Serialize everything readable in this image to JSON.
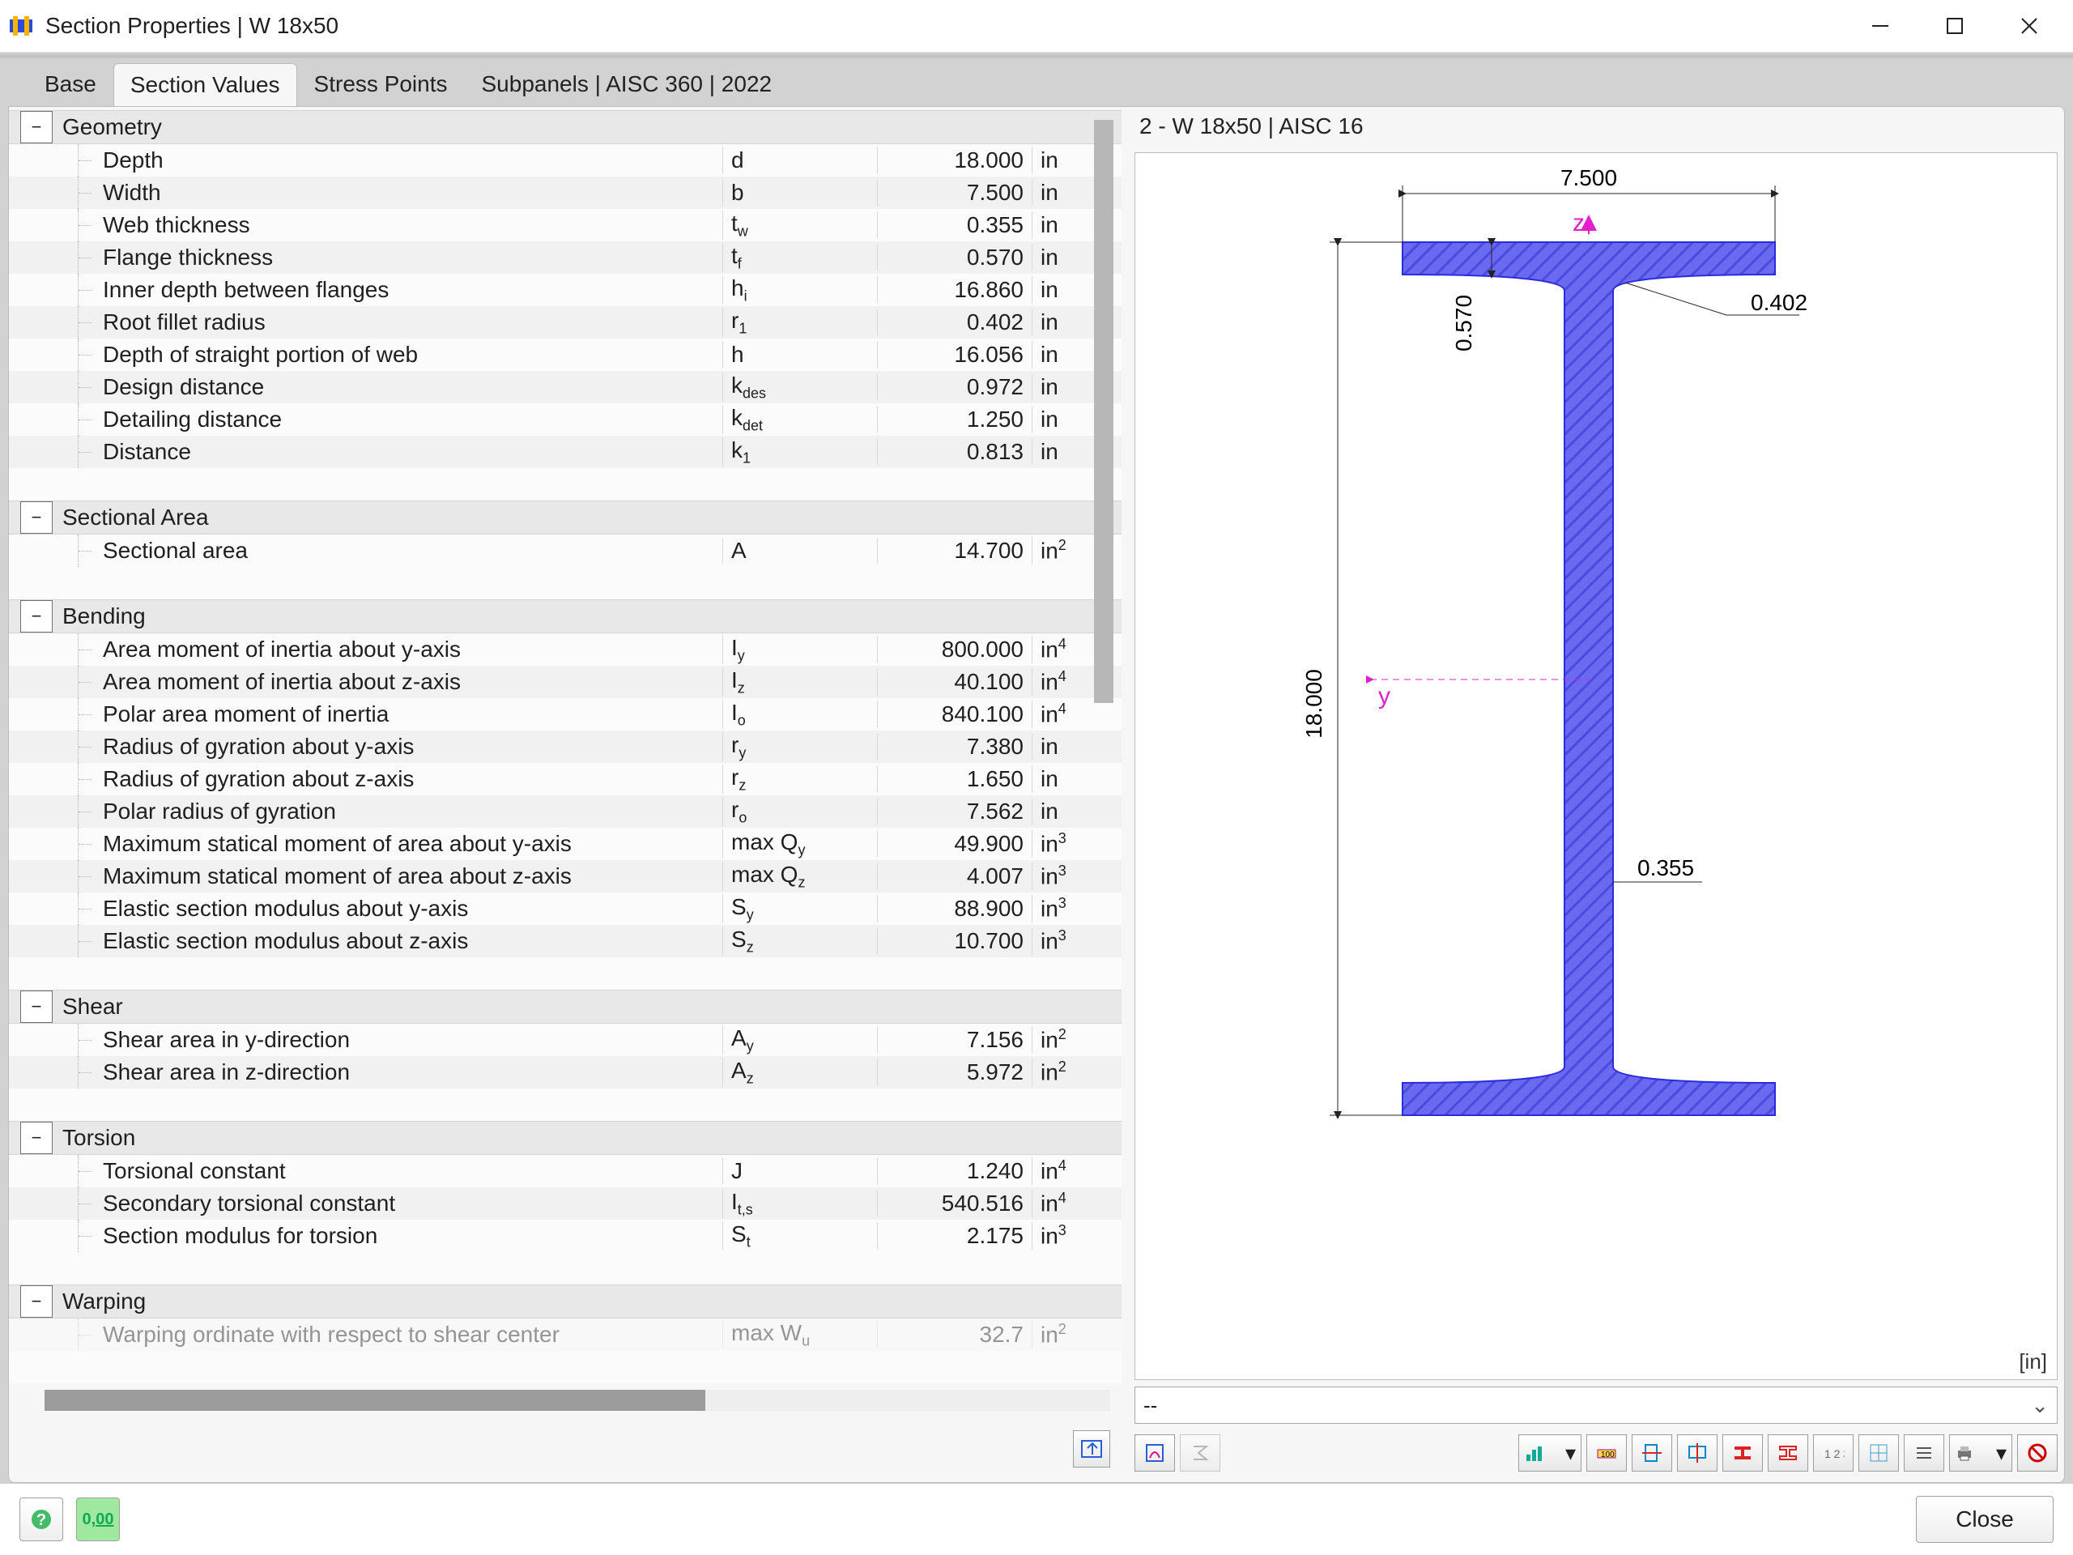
{
  "window": {
    "title": "Section Properties | W 18x50"
  },
  "tabs": [
    "Base",
    "Section Values",
    "Stress Points",
    "Subpanels | AISC 360 | 2022"
  ],
  "active_tab": 1,
  "preview_header": "2 - W 18x50 | AISC 16",
  "unit_hint": "[in]",
  "combo_value": "--",
  "footer_close": "Close",
  "diagram": {
    "depth": "18.000",
    "width": "7.500",
    "flange_t": "0.570",
    "web_t": "0.355",
    "fillet_r": "0.402",
    "axis_y": "y",
    "axis_z": "z"
  },
  "sections": [
    {
      "name": "Geometry",
      "rows": [
        {
          "label": "Depth",
          "sym": "d",
          "val": "18.000",
          "unit": "in"
        },
        {
          "label": "Width",
          "sym": "b",
          "val": "7.500",
          "unit": "in"
        },
        {
          "label": "Web thickness",
          "sym": "t<sub>w</sub>",
          "val": "0.355",
          "unit": "in"
        },
        {
          "label": "Flange thickness",
          "sym": "t<sub>f</sub>",
          "val": "0.570",
          "unit": "in"
        },
        {
          "label": "Inner depth between flanges",
          "sym": "h<sub>i</sub>",
          "val": "16.860",
          "unit": "in"
        },
        {
          "label": "Root fillet radius",
          "sym": "r<sub>1</sub>",
          "val": "0.402",
          "unit": "in"
        },
        {
          "label": "Depth of straight portion of web",
          "sym": "h",
          "val": "16.056",
          "unit": "in"
        },
        {
          "label": "Design distance",
          "sym": "k<sub>des</sub>",
          "val": "0.972",
          "unit": "in"
        },
        {
          "label": "Detailing distance",
          "sym": "k<sub>det</sub>",
          "val": "1.250",
          "unit": "in"
        },
        {
          "label": "Distance",
          "sym": "k<sub>1</sub>",
          "val": "0.813",
          "unit": "in"
        }
      ]
    },
    {
      "name": "Sectional Area",
      "rows": [
        {
          "label": "Sectional area",
          "sym": "A",
          "val": "14.700",
          "unit": "in<sup>2</sup>"
        }
      ]
    },
    {
      "name": "Bending",
      "rows": [
        {
          "label": "Area moment of inertia about y-axis",
          "sym": "I<sub>y</sub>",
          "val": "800.000",
          "unit": "in<sup>4</sup>"
        },
        {
          "label": "Area moment of inertia about z-axis",
          "sym": "I<sub>z</sub>",
          "val": "40.100",
          "unit": "in<sup>4</sup>"
        },
        {
          "label": "Polar area moment of inertia",
          "sym": "I<sub>o</sub>",
          "val": "840.100",
          "unit": "in<sup>4</sup>"
        },
        {
          "label": "Radius of gyration about y-axis",
          "sym": "r<sub>y</sub>",
          "val": "7.380",
          "unit": "in"
        },
        {
          "label": "Radius of gyration about z-axis",
          "sym": "r<sub>z</sub>",
          "val": "1.650",
          "unit": "in"
        },
        {
          "label": "Polar radius of gyration",
          "sym": "r<sub>o</sub>",
          "val": "7.562",
          "unit": "in"
        },
        {
          "label": "Maximum statical moment of area about y-axis",
          "sym": "max Q<sub>y</sub>",
          "val": "49.900",
          "unit": "in<sup>3</sup>"
        },
        {
          "label": "Maximum statical moment of area about z-axis",
          "sym": "max Q<sub>z</sub>",
          "val": "4.007",
          "unit": "in<sup>3</sup>"
        },
        {
          "label": "Elastic section modulus about y-axis",
          "sym": "S<sub>y</sub>",
          "val": "88.900",
          "unit": "in<sup>3</sup>"
        },
        {
          "label": "Elastic section modulus about z-axis",
          "sym": "S<sub>z</sub>",
          "val": "10.700",
          "unit": "in<sup>3</sup>"
        }
      ]
    },
    {
      "name": "Shear",
      "rows": [
        {
          "label": "Shear area in y-direction",
          "sym": "A<sub>y</sub>",
          "val": "7.156",
          "unit": "in<sup>2</sup>"
        },
        {
          "label": "Shear area in z-direction",
          "sym": "A<sub>z</sub>",
          "val": "5.972",
          "unit": "in<sup>2</sup>"
        }
      ]
    },
    {
      "name": "Torsion",
      "rows": [
        {
          "label": "Torsional constant",
          "sym": "J",
          "val": "1.240",
          "unit": "in<sup>4</sup>"
        },
        {
          "label": "Secondary torsional constant",
          "sym": "I<sub>t,s</sub>",
          "val": "540.516",
          "unit": "in<sup>4</sup>"
        },
        {
          "label": "Section modulus for torsion",
          "sym": "S<sub>t</sub>",
          "val": "2.175",
          "unit": "in<sup>3</sup>"
        }
      ]
    },
    {
      "name": "Warping",
      "rows": [
        {
          "label": "Warping ordinate with respect to shear center",
          "sym": "max W<sub>u</sub>",
          "val": "32.7",
          "unit": "in<sup>2</sup>",
          "cut": true
        }
      ]
    }
  ]
}
